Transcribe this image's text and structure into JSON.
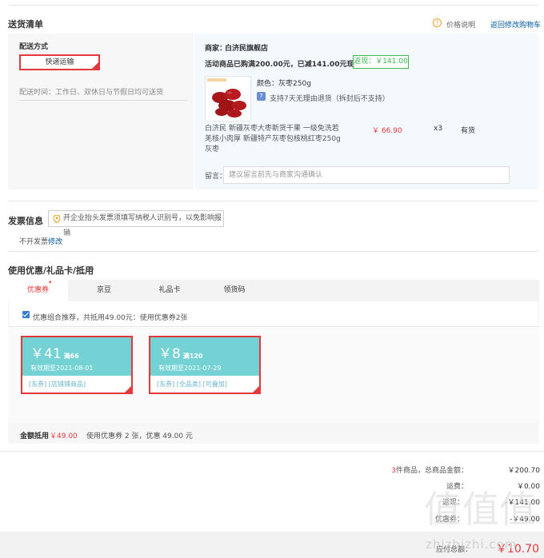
{
  "delivery": {
    "title": "送货清单",
    "price_info_link": "价格说明",
    "back_to_cart_link": "返回修改购物车",
    "shipping_method_label": "配送方式",
    "shipping_method_value": "快递运输",
    "delivery_time": "配送时间：工作日、双休日与节假日均可送货",
    "merchant_label": "商家：",
    "merchant_name": "白济民旗舰店",
    "promo_text": "活动商品已购满200.00元，已减141.00元现金",
    "rebate_text": "返现：￥141.00",
    "color_label": "颜色：",
    "color_value": "灰枣250g",
    "return_policy": "支持7天无理由退货（拆封后不支持）",
    "product_name": "白济民 新疆灰枣大枣新货干果 一级免洗若羌核小肉厚 新疆特产灰枣包核桃红枣250g 灰枣",
    "product_price": "￥ 66.90",
    "product_qty": "x3",
    "product_stock": "有货",
    "memo_label": "留言：",
    "memo_placeholder": "建议留言前先与商家沟通确认"
  },
  "invoice": {
    "title": "发票信息",
    "tip": "开企业抬头发票须填写纳税人识别号，以免影响报销",
    "status": "不开发票",
    "edit_link": "修改"
  },
  "coupons": {
    "title": "使用优惠/礼品卡/抵用",
    "tabs": [
      "优惠券",
      "京豆",
      "礼品卡",
      "领货码"
    ],
    "combo_text": "优惠组合推荐，共抵用49.00元：使用优惠券2张",
    "items": [
      {
        "amount": "￥41",
        "condition": "满66",
        "expiry": "有效期至2021-08-01",
        "tags": "[东券] [店铺铺商品]"
      },
      {
        "amount": "￥8",
        "condition": "满120",
        "expiry": "有效期至2021-07-29",
        "tags": "[东券] [全品类] [可叠加]"
      }
    ],
    "deduct_label": "金额抵用",
    "deduct_value": "￥49.00",
    "deduct_detail": "使用优惠券 2 张，优惠 49.00 元"
  },
  "summary": {
    "count": "3",
    "count_suffix": "件商品，总商品金额：",
    "goods_total": "￥200.70",
    "freight_label": "运费：",
    "freight_value": "￥0.00",
    "row3_label": "返现：",
    "row3_value": "-￥141.00",
    "row4_label": "优惠券：",
    "row4_value": "-￥49.00",
    "pay_label": "应付总额：",
    "pay_value": "￥10.70"
  },
  "watermark": {
    "logo": "值",
    "site": "zhizhizhi.com"
  },
  "colors": {
    "accent_red": "#e4393c",
    "link_blue": "#005aa0",
    "coupon_teal": "#74d2d4",
    "rebate_green": "#3fb950"
  }
}
